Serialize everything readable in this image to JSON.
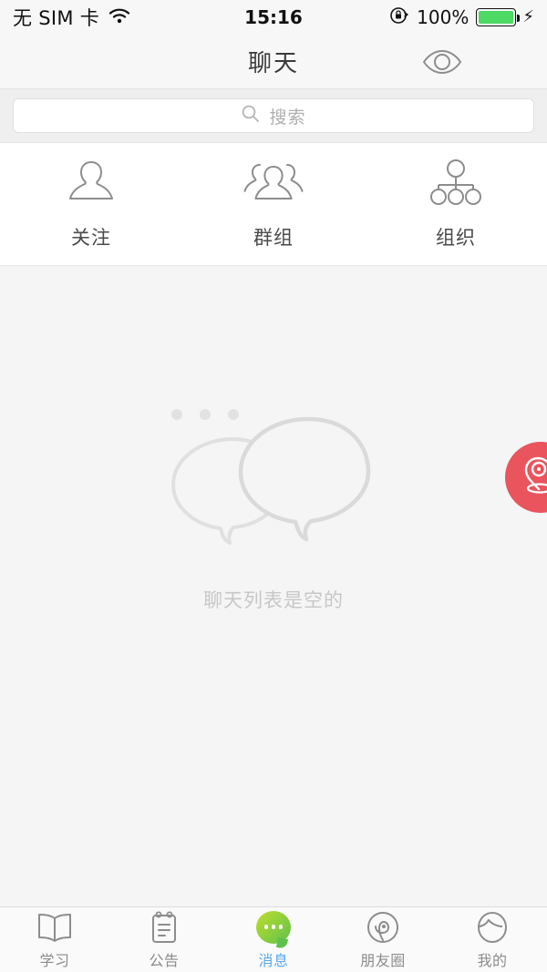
{
  "status_bar": {
    "carrier": "无 SIM 卡",
    "wifi_icon": "wifi-icon",
    "time": "15:16",
    "rotation_lock_icon": "rotation-lock-icon",
    "battery_percent": "100%",
    "battery_icon": "battery-icon",
    "charging_icon": "lightning-bolt-icon",
    "battery_color": "#4cd964"
  },
  "navbar": {
    "title": "聊天",
    "eye_icon": "eye-icon",
    "menu_icon": "hamburger-menu-icon"
  },
  "search": {
    "placeholder": "搜索",
    "icon": "search-icon"
  },
  "shortcuts": [
    {
      "label": "关注",
      "icon": "single-person-icon"
    },
    {
      "label": "群组",
      "icon": "group-people-icon"
    },
    {
      "label": "组织",
      "icon": "org-chart-icon"
    }
  ],
  "empty_state": {
    "icon": "chat-bubbles-icon",
    "text": "聊天列表是空的"
  },
  "fab": {
    "icon": "location-pin-icon",
    "color": "#e9545d"
  },
  "tabbar": {
    "active_color": "#59a9e8",
    "items": [
      {
        "label": "学习",
        "icon": "open-book-icon",
        "active": false
      },
      {
        "label": "公告",
        "icon": "clipboard-notice-icon",
        "active": false
      },
      {
        "label": "消息",
        "icon": "message-bubble-icon",
        "active": true
      },
      {
        "label": "朋友圈",
        "icon": "moments-circle-icon",
        "active": false
      },
      {
        "label": "我的",
        "icon": "profile-head-icon",
        "active": false
      }
    ]
  }
}
